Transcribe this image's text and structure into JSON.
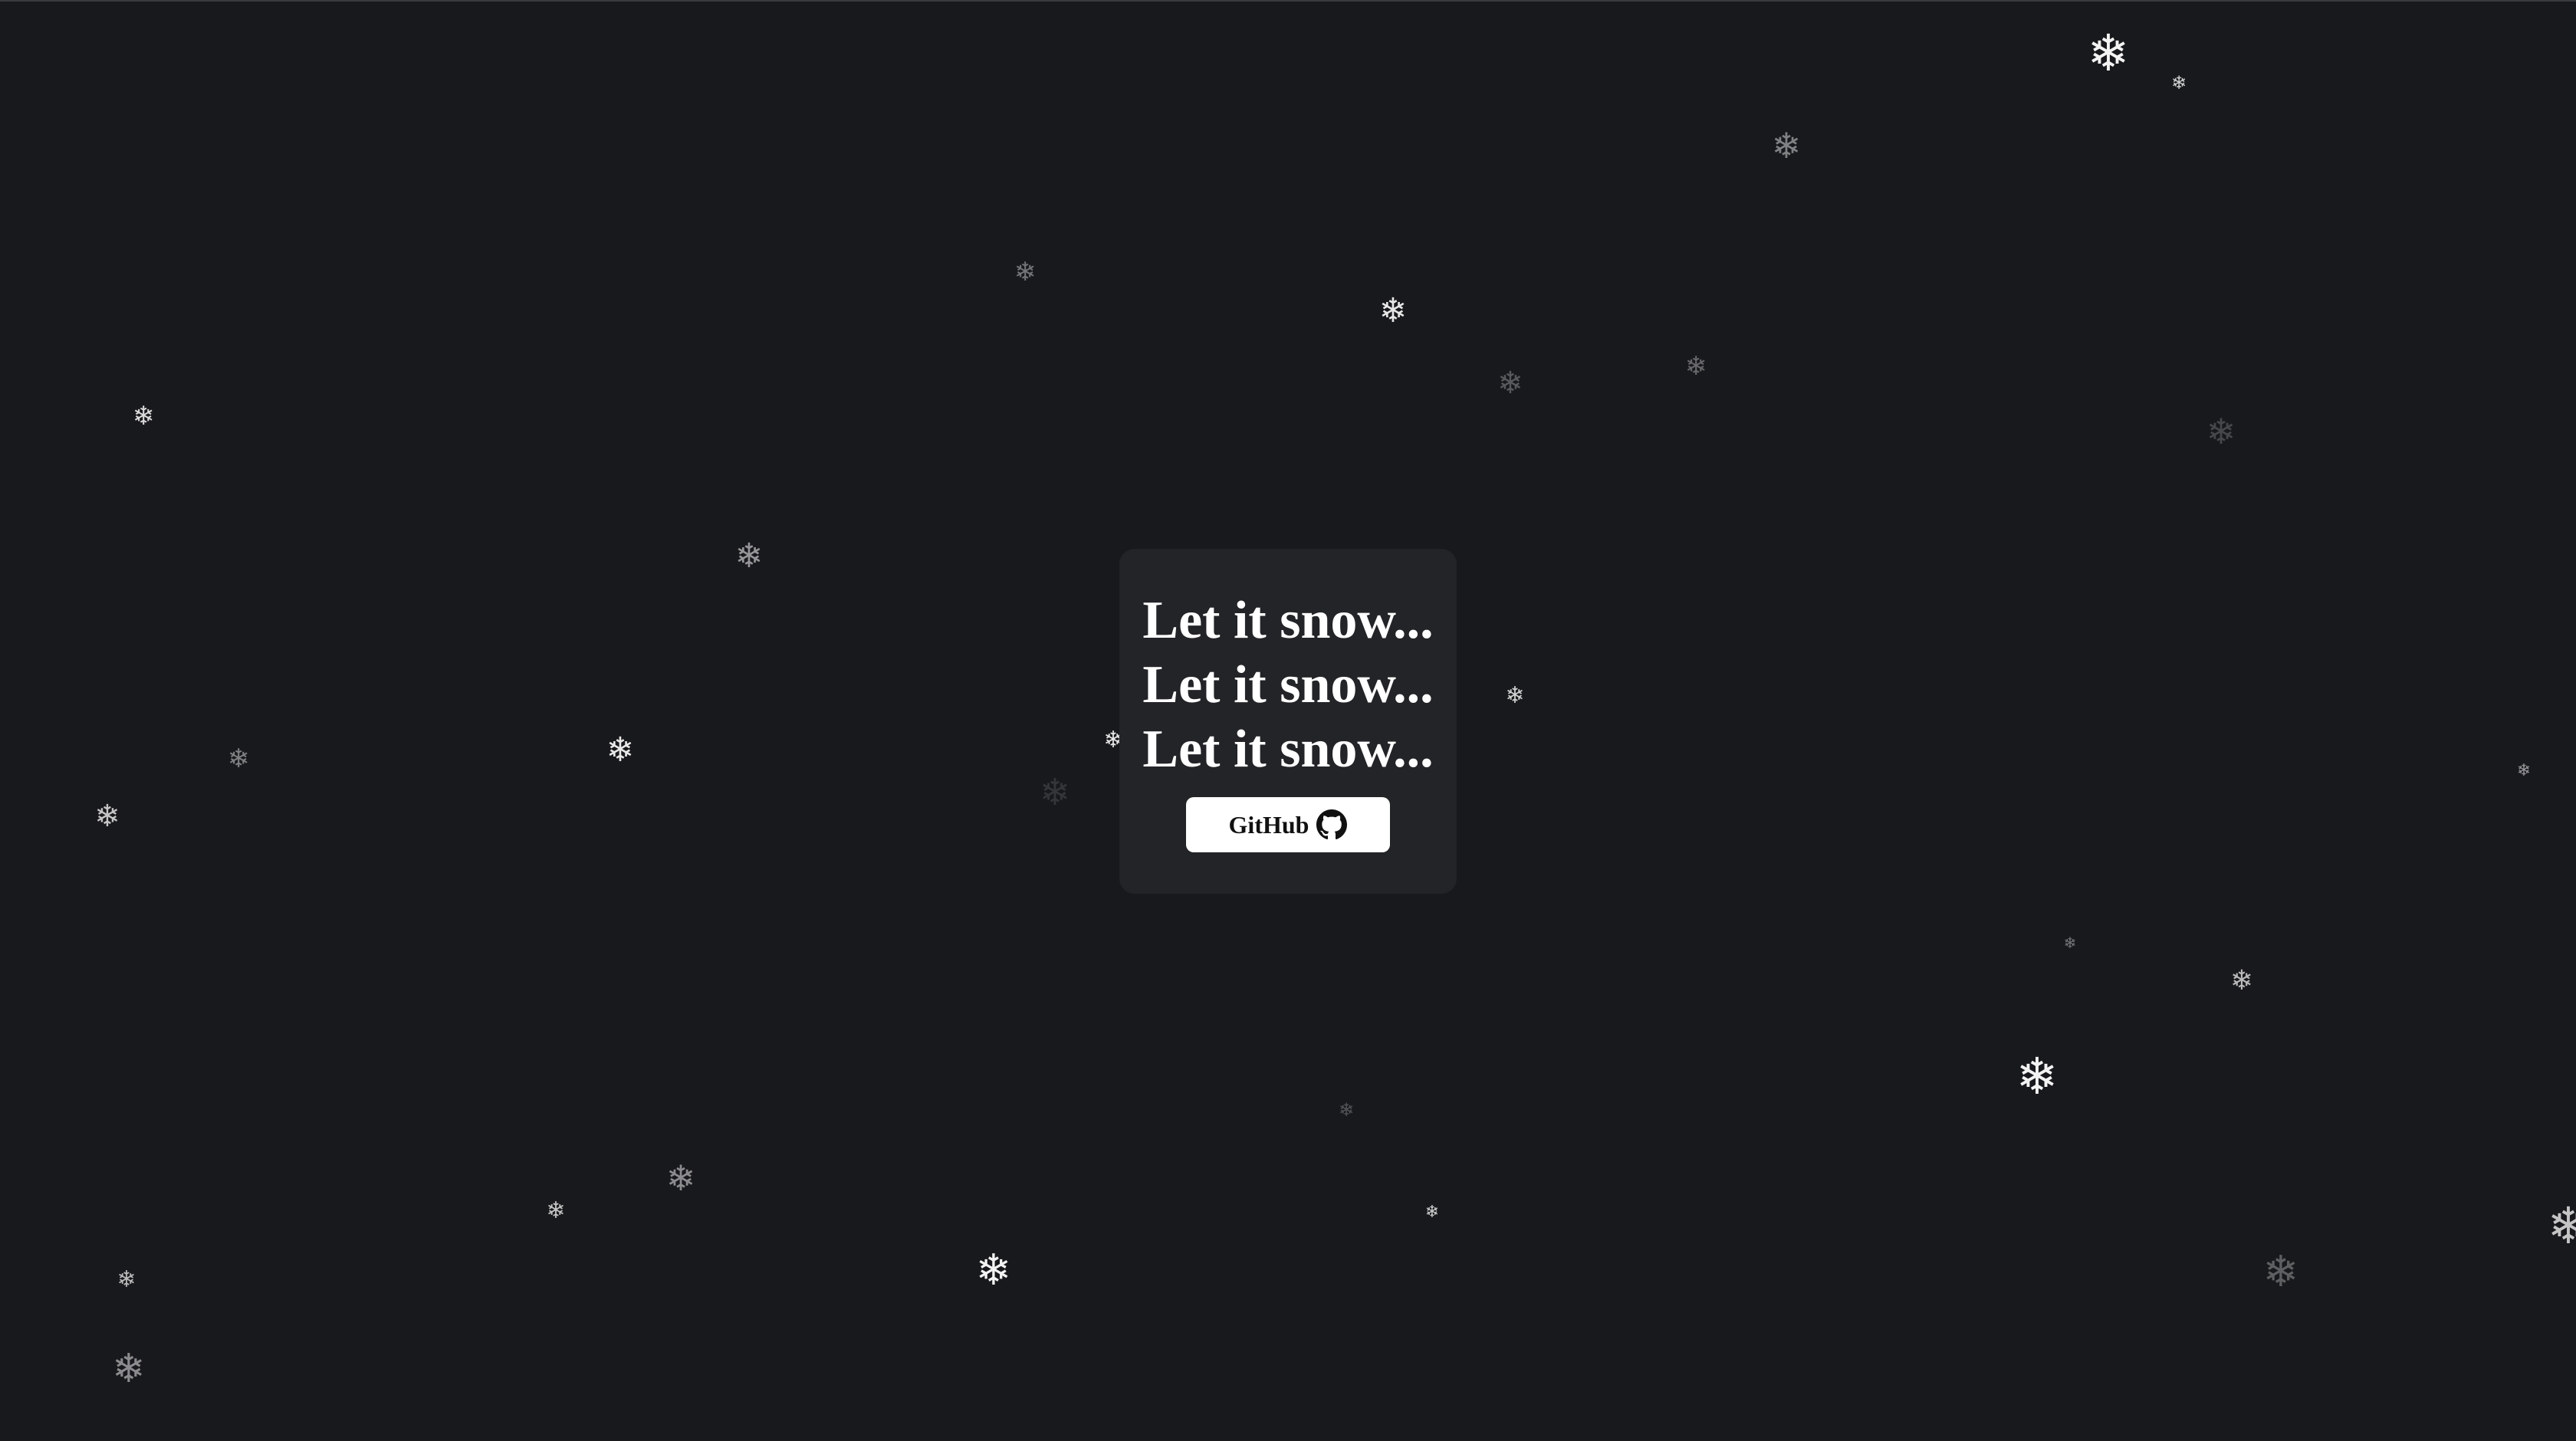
{
  "colors": {
    "background": "#18191c",
    "card": "#232427",
    "text": "#ffffff",
    "button_bg": "#ffffff",
    "button_text": "#111111"
  },
  "card": {
    "lines": [
      "Let it snow...",
      "Let it snow...",
      "Let it snow..."
    ],
    "button_label": "GitHub",
    "button_icon": "github-icon"
  },
  "snowflake_glyph": "❄"
}
